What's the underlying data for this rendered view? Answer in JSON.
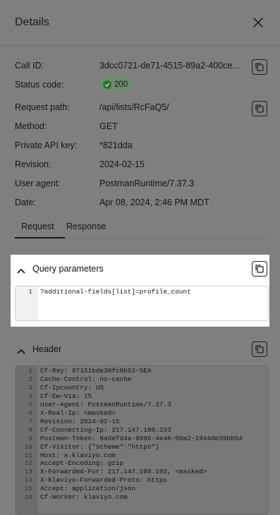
{
  "header": {
    "title": "Details",
    "close_icon": "close-icon"
  },
  "details": [
    {
      "label": "Call ID:",
      "value": "3dcc0721-de71-4515-89a2-400ce...",
      "copy": true
    },
    {
      "label": "Status code:",
      "value": "200",
      "badge": true
    },
    {
      "label": "Request path:",
      "value": "/api/lists/RcFaQ5/",
      "copy": true
    },
    {
      "label": "Method:",
      "value": "GET"
    },
    {
      "label": "Private API key:",
      "value": "*821dda"
    },
    {
      "label": "Revision:",
      "value": "2024-02-15"
    },
    {
      "label": "User agent:",
      "value": "PostmanRuntime/7.37.3"
    },
    {
      "label": "Date:",
      "value": "Apr 08, 2024, 2:46 PM MDT"
    }
  ],
  "tabs": [
    {
      "label": "Request",
      "active": true
    },
    {
      "label": "Response",
      "active": false
    }
  ],
  "query": {
    "title": "Query parameters",
    "lines": [
      "?additional-fields[list]=profile_count"
    ]
  },
  "header_panel": {
    "title": "Header",
    "lines": [
      "Cf-Ray: 87151bde30fc9b53-SEA",
      "Cache-Control: no-cache",
      "Cf-Ipcountry: US",
      "Cf-Ew-Via: 15",
      "User-Agent: PostmanRuntime/7.37.3",
      "X-Real-Ip: <masked>",
      "Revision: 2024-02-15",
      "Cf-Connecting-Ip: 217.147.188.193",
      "Postman-Token: 8adefd4a-8896-4e46-90a2-1944de39bb54",
      "Cf-Visitor: {\"scheme\":\"https\"}",
      "Host: a.klaviyo.com",
      "Accept-Encoding: gzip",
      "X-Forwarded-For: 217.147.188.193, <masked>",
      "X-Klaviyo-Forwarded-Proto: https",
      "Accept: application/json",
      "Cf-Worker: klaviyo.com"
    ]
  },
  "colors": {
    "overlay": "#7f7f7f",
    "status_ok": "#2f6e2f",
    "syntax_number": "#1c2a5a"
  }
}
